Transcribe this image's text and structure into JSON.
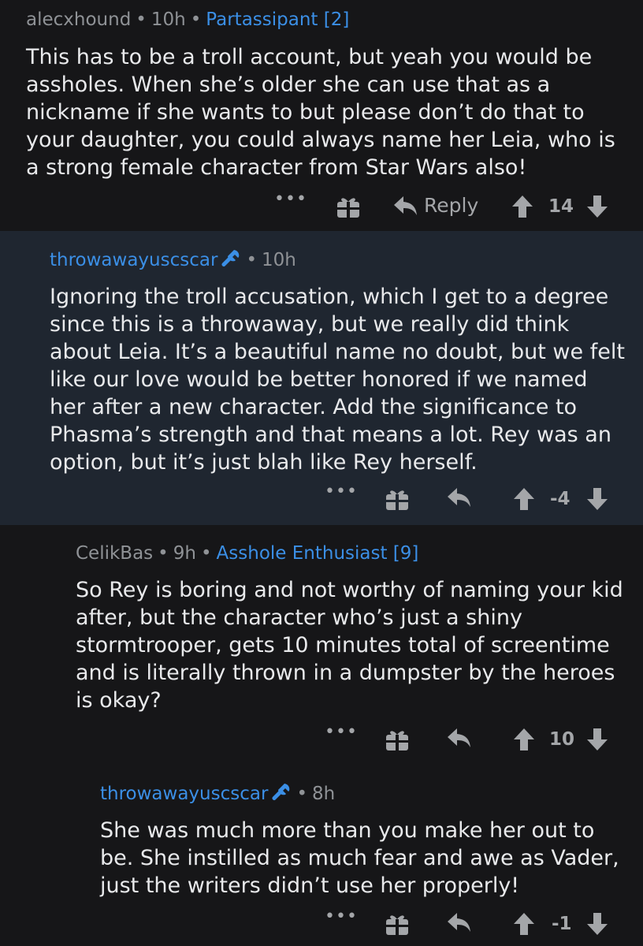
{
  "comments": [
    {
      "author": "alecxhound",
      "time": "10h",
      "flair": "Partassipant [2]",
      "body": "This has to be a troll account, but yeah you would be\nassholes. When she’s older she can use that as a\nnickname if she wants to but please don’t do that to\nyour daughter, you could always name her Leia, who is\na strong female character from Star Wars also!",
      "more": "•••",
      "reply_label": "Reply",
      "score": "14"
    },
    {
      "author": "throwawayuscscar",
      "time": "10h",
      "body": "Ignoring the troll accusation, which I get to a degree\nsince this is a throwaway, but we really did think\nabout Leia. It’s a beautiful name no doubt, but we felt\nlike our love would be better honored if we named\nher after a new character. Add the significance to\nPhasma’s strength and that means a lot. Rey was an\noption, but it’s just blah like Rey herself.",
      "more": "•••",
      "score": "-4"
    },
    {
      "author": "CelikBas",
      "time": "9h",
      "flair": "Asshole Enthusiast [9]",
      "body": "So Rey is boring and not worthy of naming your kid\nafter, but the character who’s just a shiny\nstormtrooper, gets 10 minutes total of screentime\nand is literally thrown in a dumpster by the heroes\nis okay?",
      "more": "•••",
      "score": "10"
    },
    {
      "author": "throwawayuscscar",
      "time": "8h",
      "body": "She was much more than you make her out to\nbe. She instilled as much fear and awe as Vader,\njust the writers didn’t use her properly!",
      "more": "•••",
      "score": "-1"
    }
  ],
  "separator": "•",
  "colors": {
    "background": "#161618",
    "highlight_background": "#1f2630",
    "op_author": "#3b8fe6",
    "flair": "#3b8fe6",
    "meta": "#8f9296",
    "text": "#e8e9eb"
  },
  "icons": {
    "more": "more-icon",
    "award": "gift-icon",
    "reply": "reply-arrow-icon",
    "upvote": "upvote-arrow-icon",
    "downvote": "downvote-arrow-icon",
    "op_badge": "wrench-icon"
  }
}
